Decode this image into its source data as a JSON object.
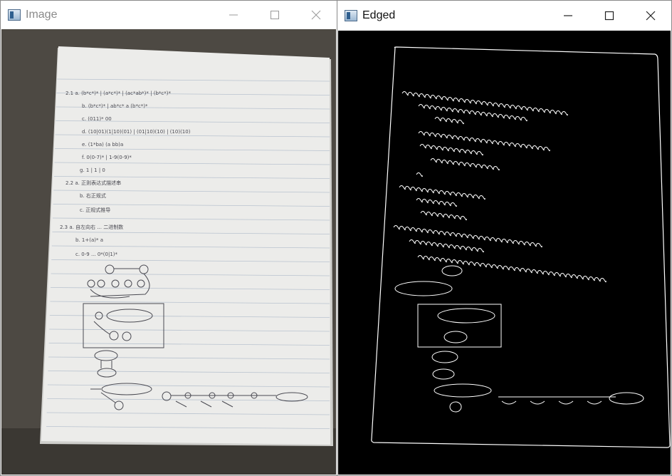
{
  "windows": [
    {
      "id": "image",
      "title": "Image"
    },
    {
      "id": "edged",
      "title": "Edged"
    }
  ],
  "controls": {
    "minimize": "minimize",
    "maximize": "maximize",
    "close": "close"
  },
  "notebook": {
    "lines": [
      "2.1 a.  (b*c*)* | (a*c*)* | (ac*ab*)* | (b*c*)*",
      "b.  (b*c*)* | ab*c* a (b*c*)*",
      "c.  (011)* 00",
      "d.  (10|01)(1|10)(01) | (01|10)(10) | (10)(10)",
      "e.  (1*ba) (a bb)a",
      "f.  0(0-7)* | 1-9(0-9)*",
      "g.  1 | 1 | 0",
      "2.2 a. 正则表达式描述串",
      "b. 右正规式",
      "c. 正规式推导",
      "2.3 a. 自左向右 ... 二进制数",
      "b. 1+(a)* a",
      "c. 0-9 ... 0*(0|1)*"
    ]
  },
  "colors": {
    "paper": "#ececea",
    "desk": "#4a4640",
    "ink": "#4a4a52",
    "rule": "#b9c3cf",
    "edge": "#ffffff",
    "edge_bg": "#000000"
  }
}
